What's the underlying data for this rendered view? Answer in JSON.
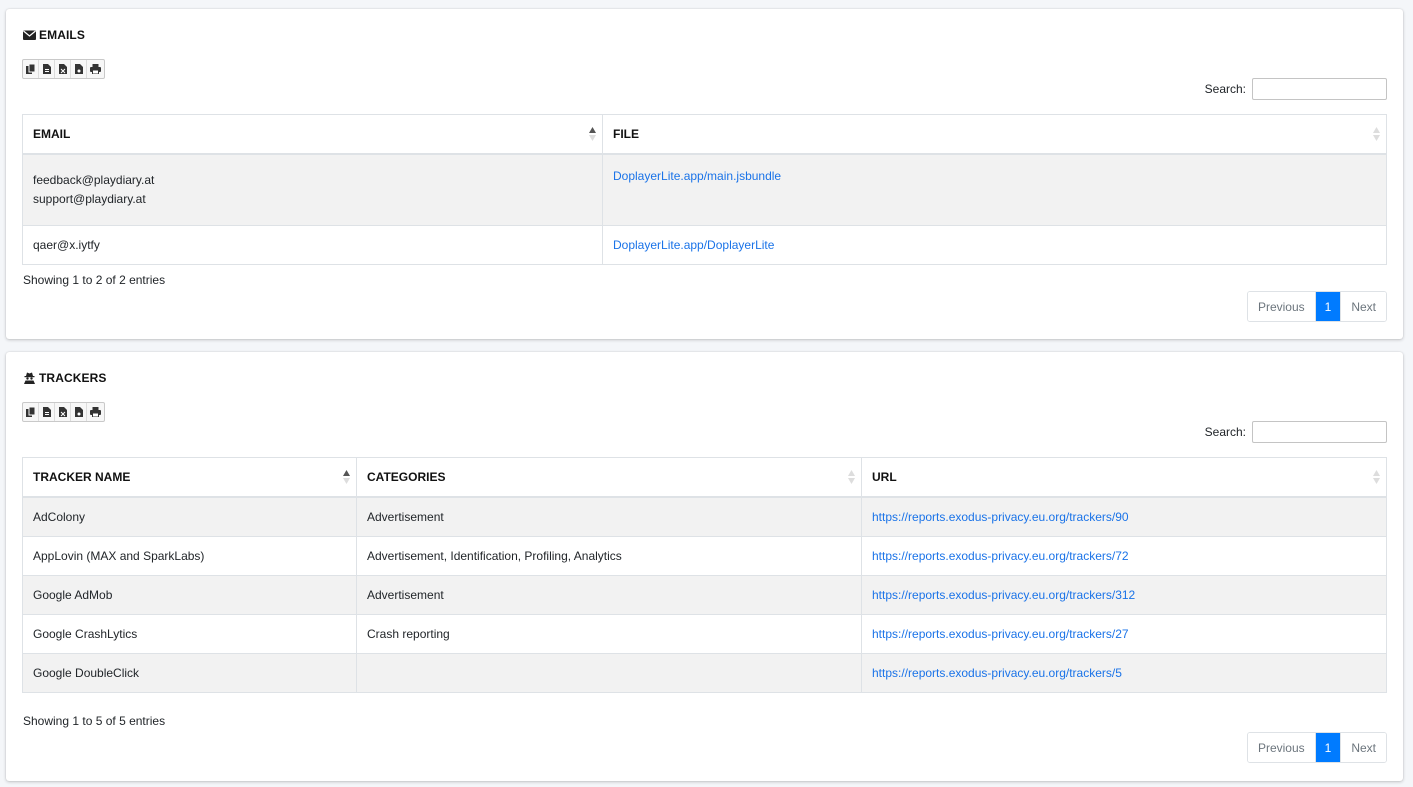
{
  "emails": {
    "title": "EMAILS",
    "title_icon": "envelope-icon",
    "export_buttons": [
      "copy-icon",
      "csv-icon",
      "excel-icon",
      "pdf-icon",
      "print-icon"
    ],
    "search_label": "Search:",
    "search_value": "",
    "columns": [
      "EMAIL",
      "FILE"
    ],
    "rows": [
      {
        "emails": [
          "feedback@playdiary.at",
          "support@playdiary.at"
        ],
        "file": "DoplayerLite.app/main.jsbundle"
      },
      {
        "emails": [
          "qaer@x.iytfy"
        ],
        "file": "DoplayerLite.app/DoplayerLite"
      }
    ],
    "info": "Showing 1 to 2 of 2 entries",
    "pager": {
      "previous": "Previous",
      "page": "1",
      "next": "Next"
    }
  },
  "trackers": {
    "title": "TRACKERS",
    "title_icon": "user-secret-icon",
    "export_buttons": [
      "copy-icon",
      "csv-icon",
      "excel-icon",
      "pdf-icon",
      "print-icon"
    ],
    "search_label": "Search:",
    "search_value": "",
    "columns": [
      "TRACKER NAME",
      "CATEGORIES",
      "URL"
    ],
    "rows": [
      {
        "name": "AdColony",
        "categories": "Advertisement",
        "url": "https://reports.exodus-privacy.eu.org/trackers/90"
      },
      {
        "name": "AppLovin (MAX and SparkLabs)",
        "categories": "Advertisement, Identification, Profiling, Analytics",
        "url": "https://reports.exodus-privacy.eu.org/trackers/72"
      },
      {
        "name": "Google AdMob",
        "categories": "Advertisement",
        "url": "https://reports.exodus-privacy.eu.org/trackers/312"
      },
      {
        "name": "Google CrashLytics",
        "categories": "Crash reporting",
        "url": "https://reports.exodus-privacy.eu.org/trackers/27"
      },
      {
        "name": "Google DoubleClick",
        "categories": "",
        "url": "https://reports.exodus-privacy.eu.org/trackers/5"
      }
    ],
    "info": "Showing 1 to 5 of 5 entries",
    "pager": {
      "previous": "Previous",
      "page": "1",
      "next": "Next"
    }
  },
  "colors": {
    "link": "#1a73e8",
    "active_page": "#007bff",
    "stripe": "#f2f2f2"
  }
}
